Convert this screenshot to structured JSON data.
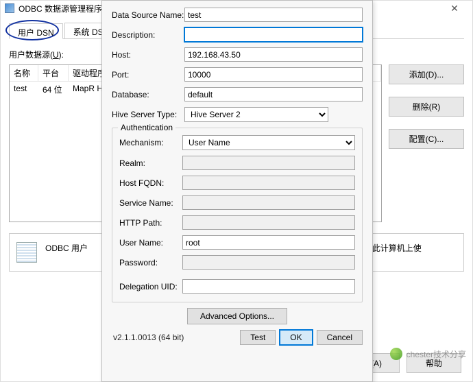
{
  "main": {
    "title": "ODBC 数据源管理程序",
    "tabs": {
      "user_dsn": "用户 DSN",
      "system_dsn": "系统 DSN"
    },
    "ds_label_prefix": "用户数据源(",
    "ds_label_u": "U",
    "ds_label_suffix": "):",
    "columns": {
      "name": "名称",
      "platform": "平台",
      "driver": "驱动程序"
    },
    "row": {
      "name": "test",
      "platform": "64 位",
      "driver": "MapR H"
    },
    "side": {
      "add": "添加(D)...",
      "delete": "删除(R)",
      "config": "配置(C)..."
    },
    "info_prefix": "ODBC 用户",
    "info_suffix": "您可见，而且只能在此计算机上使",
    "bottom": {
      "apply": "用(A)",
      "help": "帮助"
    }
  },
  "dialog": {
    "fields": {
      "data_source_name": {
        "label": "Data Source Name:",
        "value": "test"
      },
      "description": {
        "label": "Description:",
        "value": ""
      },
      "host": {
        "label": "Host:",
        "value": "192.168.43.50"
      },
      "port": {
        "label": "Port:",
        "value": "10000"
      },
      "database": {
        "label": "Database:",
        "value": "default"
      },
      "hive_server_type": {
        "label": "Hive Server Type:",
        "value": "Hive Server 2"
      }
    },
    "auth": {
      "legend": "Authentication",
      "mechanism": {
        "label": "Mechanism:",
        "value": "User Name"
      },
      "realm": {
        "label": "Realm:",
        "value": ""
      },
      "host_fqdn": {
        "label": "Host FQDN:",
        "value": ""
      },
      "service_name": {
        "label": "Service Name:",
        "value": ""
      },
      "http_path": {
        "label": "HTTP Path:",
        "value": ""
      },
      "user_name": {
        "label": "User Name:",
        "value": "root"
      },
      "password": {
        "label": "Password:",
        "value": ""
      },
      "delegation_uid": {
        "label": "Delegation UID:",
        "value": ""
      }
    },
    "advanced": "Advanced Options...",
    "version": "v2.1.1.0013 (64 bit)",
    "buttons": {
      "test": "Test",
      "ok": "OK",
      "cancel": "Cancel"
    }
  },
  "watermark": "chester技术分享"
}
